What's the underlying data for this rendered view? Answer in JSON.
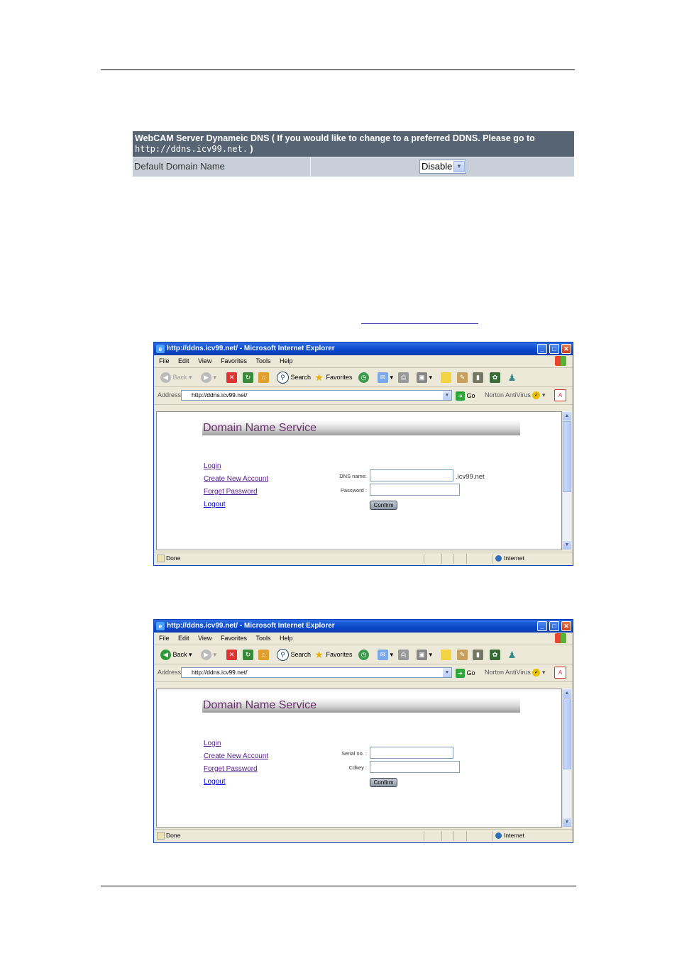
{
  "ddns_panel": {
    "header_line1": "WebCAM Server Dynameic DNS ( If you would like to change to a preferred DDNS. Please go to",
    "header_url": "http://ddns.icv99.net.",
    "header_end": " )",
    "row_label": "Default Domain Name",
    "select_value": "Disable"
  },
  "browser": {
    "title": "http://ddns.icv99.net/ - Microsoft Internet Explorer",
    "menu": [
      "File",
      "Edit",
      "View",
      "Favorites",
      "Tools",
      "Help"
    ],
    "toolbar": {
      "back": "Back",
      "search": "Search",
      "favorites": "Favorites"
    },
    "address_label": "Address",
    "address_value": "http://ddns.icv99.net/",
    "go": "Go",
    "norton": "Norton AntiVirus",
    "status": "Done",
    "zone": "Internet"
  },
  "page": {
    "title": "Domain Name Service",
    "nav": {
      "login": "Login",
      "create": "Create New Account",
      "forget": "Forget Password",
      "logout": "Logout"
    },
    "confirm": "Confirm"
  },
  "form1": {
    "field1_label": "DNS name:",
    "field1_suffix": ".icv99.net",
    "field2_label": "Password :"
  },
  "form2": {
    "field1_label": "Serial no. :",
    "field2_label": "Cdkey :"
  }
}
